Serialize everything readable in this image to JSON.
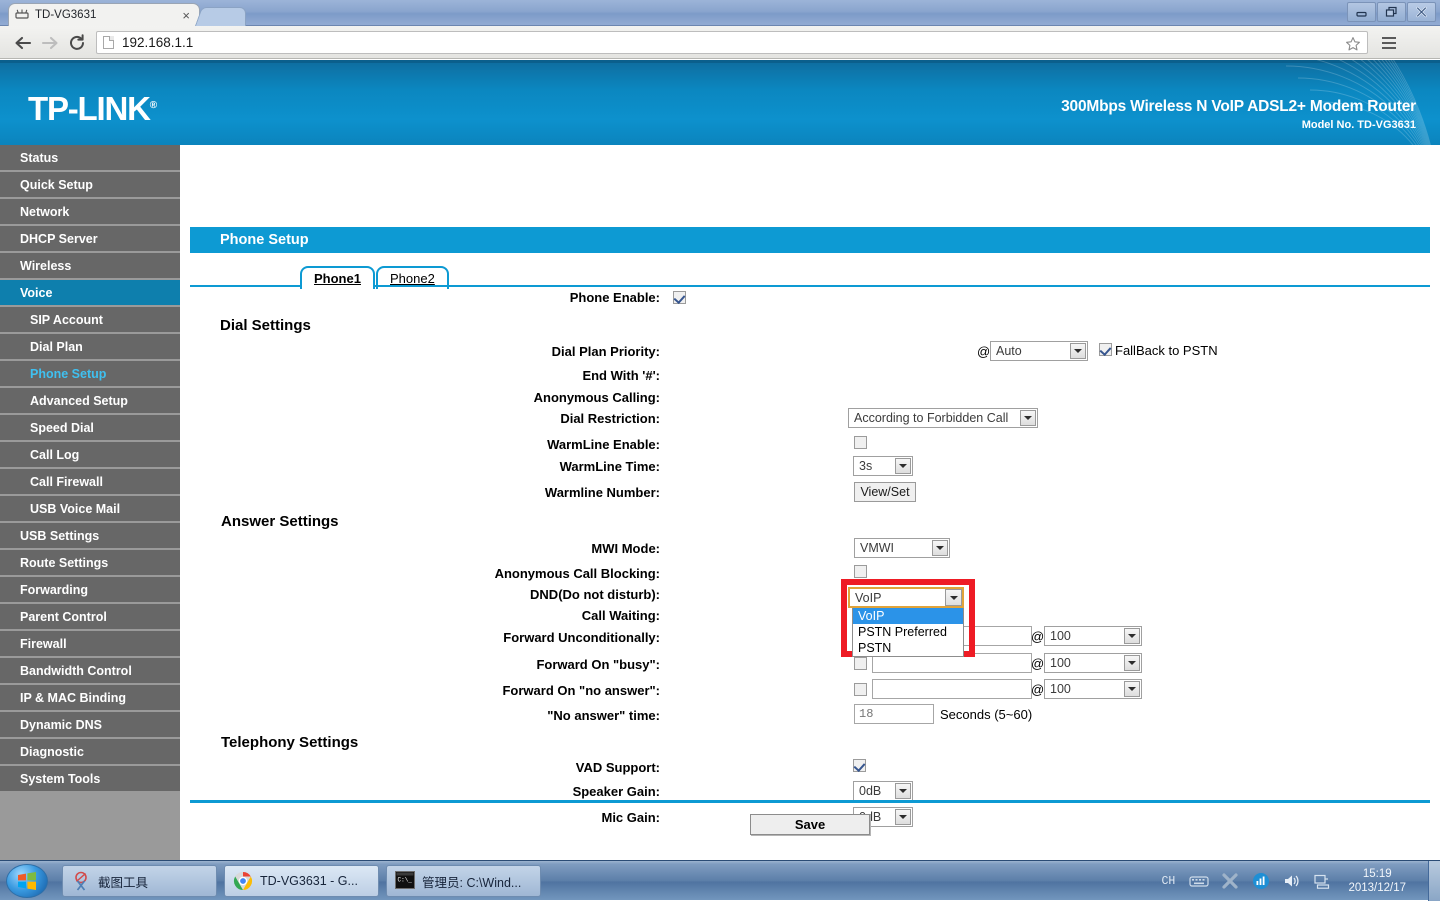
{
  "browser": {
    "tab_title": "TD-VG3631",
    "tab_close": "×",
    "url": "192.168.1.1",
    "window_minimize": "–",
    "window_restore": "❐",
    "window_close": "✕"
  },
  "banner": {
    "logo": "TP-LINK",
    "logo_reg": "®",
    "product": "300Mbps Wireless N VoIP ADSL2+ Modem Router",
    "model": "Model No. TD-VG3631"
  },
  "sidebar": {
    "items": [
      {
        "label": "Status",
        "level": "top",
        "state": "normal"
      },
      {
        "label": "Quick Setup",
        "level": "top",
        "state": "normal"
      },
      {
        "label": "Network",
        "level": "top",
        "state": "normal"
      },
      {
        "label": "DHCP Server",
        "level": "top",
        "state": "normal"
      },
      {
        "label": "Wireless",
        "level": "top",
        "state": "normal"
      },
      {
        "label": "Voice",
        "level": "top",
        "state": "active"
      },
      {
        "label": "SIP Account",
        "level": "sub",
        "state": "normal"
      },
      {
        "label": "Dial Plan",
        "level": "sub",
        "state": "normal"
      },
      {
        "label": "Phone Setup",
        "level": "sub",
        "state": "current"
      },
      {
        "label": "Advanced Setup",
        "level": "sub",
        "state": "normal"
      },
      {
        "label": "Speed Dial",
        "level": "sub",
        "state": "normal"
      },
      {
        "label": "Call Log",
        "level": "sub",
        "state": "normal"
      },
      {
        "label": "Call Firewall",
        "level": "sub",
        "state": "normal"
      },
      {
        "label": "USB Voice Mail",
        "level": "sub",
        "state": "normal"
      },
      {
        "label": "USB Settings",
        "level": "top",
        "state": "normal"
      },
      {
        "label": "Route Settings",
        "level": "top",
        "state": "normal"
      },
      {
        "label": "Forwarding",
        "level": "top",
        "state": "normal"
      },
      {
        "label": "Parent Control",
        "level": "top",
        "state": "normal"
      },
      {
        "label": "Firewall",
        "level": "top",
        "state": "normal"
      },
      {
        "label": "Bandwidth Control",
        "level": "top",
        "state": "normal"
      },
      {
        "label": "IP & MAC Binding",
        "level": "top",
        "state": "normal"
      },
      {
        "label": "Dynamic DNS",
        "level": "top",
        "state": "normal"
      },
      {
        "label": "Diagnostic",
        "level": "top",
        "state": "normal"
      },
      {
        "label": "System Tools",
        "level": "top",
        "state": "normal"
      }
    ]
  },
  "page": {
    "title": "Phone Setup",
    "tabs": [
      {
        "label": "Phone1",
        "selected": true
      },
      {
        "label": "Phone2",
        "selected": false
      }
    ],
    "phone_enable_label": "Phone Enable:",
    "phone_enable_checked": true,
    "sections": {
      "dial": "Dial Settings",
      "answer": "Answer Settings",
      "telephony": "Telephony Settings"
    },
    "dial_settings": {
      "dial_plan_priority_label": "Dial Plan Priority:",
      "dial_plan_priority_value": "VoIP",
      "dial_plan_priority_options": [
        "VoIP",
        "PSTN Preferred",
        "PSTN"
      ],
      "dial_plan_priority_highlighted": "VoIP",
      "at_symbol": "@",
      "sip_account_value": "Auto",
      "fallback_label": "FallBack to PSTN",
      "fallback_checked": true,
      "end_with_hash_label": "End With '#':",
      "anonymous_calling_label": "Anonymous Calling:",
      "dial_restriction_label": "Dial Restriction:",
      "dial_restriction_value": "According to Forbidden Call",
      "warmline_enable_label": "WarmLine Enable:",
      "warmline_enable_checked": false,
      "warmline_time_label": "WarmLine Time:",
      "warmline_time_value": "3s",
      "warmline_number_label": "Warmline Number:",
      "warmline_number_button": "View/Set"
    },
    "answer_settings": {
      "mwi_mode_label": "MWI Mode:",
      "mwi_mode_value": "VMWI",
      "anonymous_call_blocking_label": "Anonymous Call Blocking:",
      "anonymous_call_blocking_checked": false,
      "dnd_label": "DND(Do not disturb):",
      "dnd_checked": false,
      "call_waiting_label": "Call Waiting:",
      "call_waiting_checked": false,
      "forward_uncond_label": "Forward Unconditionally:",
      "forward_uncond_checked": false,
      "forward_uncond_value": "",
      "forward_uncond_account": "100",
      "forward_busy_label": "Forward On \"busy\":",
      "forward_busy_checked": false,
      "forward_busy_value": "",
      "forward_busy_account": "100",
      "forward_noanswer_label": "Forward On \"no answer\":",
      "forward_noanswer_checked": false,
      "forward_noanswer_value": "",
      "forward_noanswer_account": "100",
      "no_answer_time_label": "\"No answer\" time:",
      "no_answer_time_value": "18",
      "no_answer_time_hint": "Seconds (5~60)",
      "at_symbol": "@"
    },
    "telephony_settings": {
      "vad_label": "VAD Support:",
      "vad_checked": true,
      "speaker_gain_label": "Speaker Gain:",
      "speaker_gain_value": "0dB",
      "mic_gain_label": "Mic Gain:",
      "mic_gain_value": "0dB"
    },
    "save_button": "Save"
  },
  "taskbar": {
    "items": [
      {
        "label": "截图工具",
        "icon": "snipping-tool-icon",
        "active": false
      },
      {
        "label": "TD-VG3631 - G...",
        "icon": "chrome-icon",
        "active": true
      },
      {
        "label": "管理员: C:\\Wind...",
        "icon": "console-icon",
        "active": false
      }
    ],
    "tray": {
      "input_language": "CH",
      "time": "15:19",
      "date": "2013/12/17"
    }
  },
  "colors": {
    "brand_blue": "#0d9ad3",
    "banner_blue": "#0b87c0",
    "sidebar_item": "#676767",
    "sidebar_active": "#0e7fad",
    "sidebar_current_text": "#3fc0f0",
    "highlight_red": "#ee1b24",
    "dropdown_highlight": "#2b93e8",
    "focus_orange": "#e0a33a"
  }
}
